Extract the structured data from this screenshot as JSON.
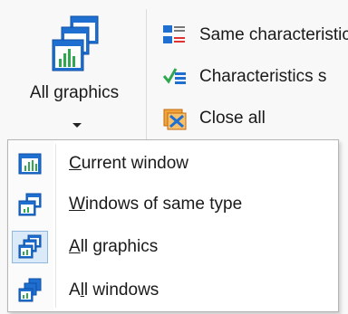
{
  "ribbon": {
    "big_button": {
      "label": "All graphics"
    },
    "small_buttons": [
      {
        "label": "Same characteristics",
        "icon": "same-characteristics-icon"
      },
      {
        "label": "Characteristics s",
        "icon": "characteristics-sort-icon"
      },
      {
        "label": "Close all",
        "icon": "close-all-icon"
      }
    ]
  },
  "dropdown": {
    "items": [
      {
        "prefix": "",
        "accel": "C",
        "rest": "urrent window",
        "icon": "current-window-icon",
        "checked": false
      },
      {
        "prefix": "",
        "accel": "W",
        "rest": "indows of same type",
        "icon": "windows-same-type-icon",
        "checked": false
      },
      {
        "prefix": "",
        "accel": "A",
        "rest": "ll graphics",
        "icon": "all-graphics-icon",
        "checked": true
      },
      {
        "prefix": "A",
        "accel": "l",
        "rest": "l windows",
        "icon": "all-windows-icon",
        "checked": false
      }
    ]
  },
  "colors": {
    "accent_blue": "#1f6fd1",
    "chart_green": "#2fa84f",
    "checked_bg": "#dbeaf8"
  }
}
